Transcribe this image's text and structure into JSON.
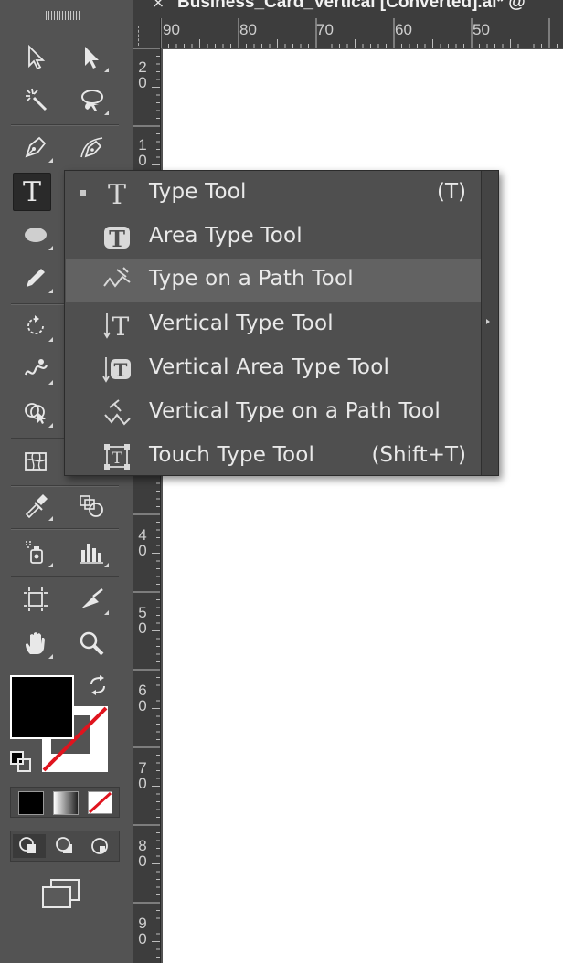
{
  "document": {
    "tab_close": "×",
    "tab_title": "Business_Card_Vertical [Converted].ai* @"
  },
  "rulers": {
    "horizontal": [
      "90",
      "80",
      "70",
      "60",
      "50"
    ],
    "vertical": [
      "20",
      "10",
      "40",
      "50",
      "60",
      "70",
      "80",
      "90"
    ]
  },
  "toolbar": {
    "tools": [
      {
        "name": "selection-tool",
        "icon": "arrow-icon"
      },
      {
        "name": "direct-selection-tool",
        "icon": "white-arrow-icon"
      },
      {
        "name": "magic-wand-tool",
        "icon": "magic-wand-icon"
      },
      {
        "name": "lasso-tool",
        "icon": "lasso-icon"
      },
      {
        "name": "pen-tool",
        "icon": "pen-icon"
      },
      {
        "name": "curvature-tool",
        "icon": "curvature-pen-icon"
      },
      {
        "name": "type-tool",
        "icon": "type-icon",
        "glyph": "T"
      },
      {
        "name": "ellipse-tool",
        "icon": "ellipse-icon"
      },
      {
        "name": "pencil-tool",
        "icon": "pencil-icon"
      },
      {
        "name": "rotate-tool",
        "icon": "rotate-icon"
      },
      {
        "name": "warp-tool",
        "icon": "warp-icon"
      },
      {
        "name": "shape-builder-tool",
        "icon": "shape-builder-icon"
      },
      {
        "name": "mesh-tool",
        "icon": "mesh-icon"
      },
      {
        "name": "eyedropper-tool",
        "icon": "eyedropper-icon"
      },
      {
        "name": "blend-tool",
        "icon": "blend-icon"
      },
      {
        "name": "symbol-sprayer-tool",
        "icon": "spray-icon"
      },
      {
        "name": "column-graph-tool",
        "icon": "bar-graph-icon"
      },
      {
        "name": "artboard-tool",
        "icon": "artboard-icon"
      },
      {
        "name": "slice-tool",
        "icon": "slice-icon"
      },
      {
        "name": "hand-tool",
        "icon": "hand-icon"
      },
      {
        "name": "zoom-tool",
        "icon": "magnifier-icon"
      }
    ],
    "fill_color": "#000000",
    "stroke": "none"
  },
  "flyout": {
    "items": [
      {
        "label": "Type Tool",
        "shortcut": "(T)",
        "checked": true,
        "highlighted": false
      },
      {
        "label": "Area Type Tool",
        "shortcut": "",
        "checked": false,
        "highlighted": false
      },
      {
        "label": "Type on a Path Tool",
        "shortcut": "",
        "checked": false,
        "highlighted": true
      },
      {
        "label": "Vertical Type Tool",
        "shortcut": "",
        "checked": false,
        "highlighted": false
      },
      {
        "label": "Vertical Area Type Tool",
        "shortcut": "",
        "checked": false,
        "highlighted": false
      },
      {
        "label": "Vertical Type on a Path Tool",
        "shortcut": "",
        "checked": false,
        "highlighted": false
      },
      {
        "label": "Touch Type Tool",
        "shortcut": "(Shift+T)",
        "checked": false,
        "highlighted": false
      }
    ]
  },
  "colors": {
    "panel": "#535353",
    "menu_bg": "#4f4f4f",
    "menu_highlight": "#626262",
    "text": "#e9e9e9",
    "stroke_none_red": "#e0141e"
  }
}
